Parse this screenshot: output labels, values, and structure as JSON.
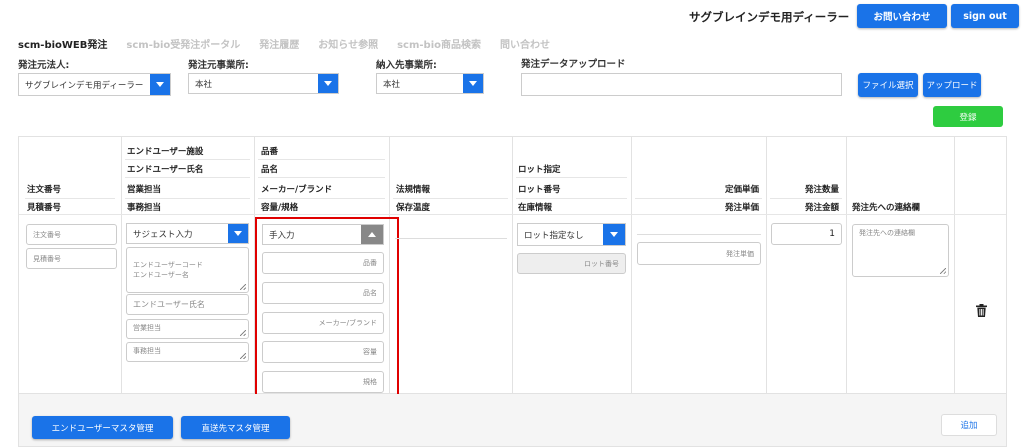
{
  "header": {
    "dealer_name": "サグブレインデモ用ディーラー",
    "contact_button": "お問い合わせ",
    "signout_button": "sign out"
  },
  "nav": {
    "items": [
      "scm-bioWEB発注",
      "scm-bio受発注ポータル",
      "発注履歴",
      "お知らせ参照",
      "scm-bio商品検索",
      "問い合わせ"
    ],
    "active_index": 0
  },
  "filters": {
    "source_label": "発注元法人:",
    "source_value": "サグブレインデモ用ディーラー",
    "office_label": "発注元事業所:",
    "office_value": "本社",
    "delivery_label": "納入先事業所:",
    "delivery_value": "本社",
    "upload_label": "発注データアップロード",
    "file_button": "ファイル選択",
    "upload_button": "アップロード"
  },
  "register_button": "登録",
  "table": {
    "headers": {
      "col1": [
        "注文番号",
        "見積番号"
      ],
      "col2": [
        "エンドユーザー施設",
        "エンドユーザー氏名",
        "営業担当",
        "事務担当"
      ],
      "col3": [
        "品番",
        "品名",
        "メーカー/ブランド",
        "容量/規格"
      ],
      "col4": [
        "法規情報",
        "保存温度"
      ],
      "col5": [
        "ロット指定",
        "ロット番号",
        "在庫情報"
      ],
      "col6": [
        "定価単価",
        "発注単価"
      ],
      "col7": [
        "発注数量",
        "発注金額"
      ],
      "col8": [
        "発注先への連絡欄"
      ]
    },
    "row": {
      "order_no_placeholder": "注文番号",
      "estimate_no_placeholder": "見積番号",
      "suggest_select": "サジェスト入力",
      "enduser_code_text": "エンドユーザーコード\nエンドユーザー名",
      "enduser_name_placeholder": "エンドユーザー氏名",
      "sales_placeholder": "営業担当",
      "clerk_placeholder": "事務担当",
      "manual_select": "手入力",
      "part_no_placeholder": "品番",
      "product_name_placeholder": "品名",
      "maker_placeholder": "メーカー/ブランド",
      "capacity_placeholder": "容量",
      "spec_placeholder": "規格",
      "lot_select": "ロット指定なし",
      "lot_no_placeholder": "ロット番号",
      "unit_price_placeholder": "発注単価",
      "quantity_value": "1",
      "note_placeholder": "発注先への連絡欄"
    }
  },
  "footer": {
    "enduser_master_button": "エンドユーザーマスタ管理",
    "delivery_master_button": "直送先マスタ管理",
    "add_button": "追加"
  },
  "colors": {
    "primary": "#1a73e8",
    "success": "#2ecc40",
    "highlight": "#e00000"
  }
}
